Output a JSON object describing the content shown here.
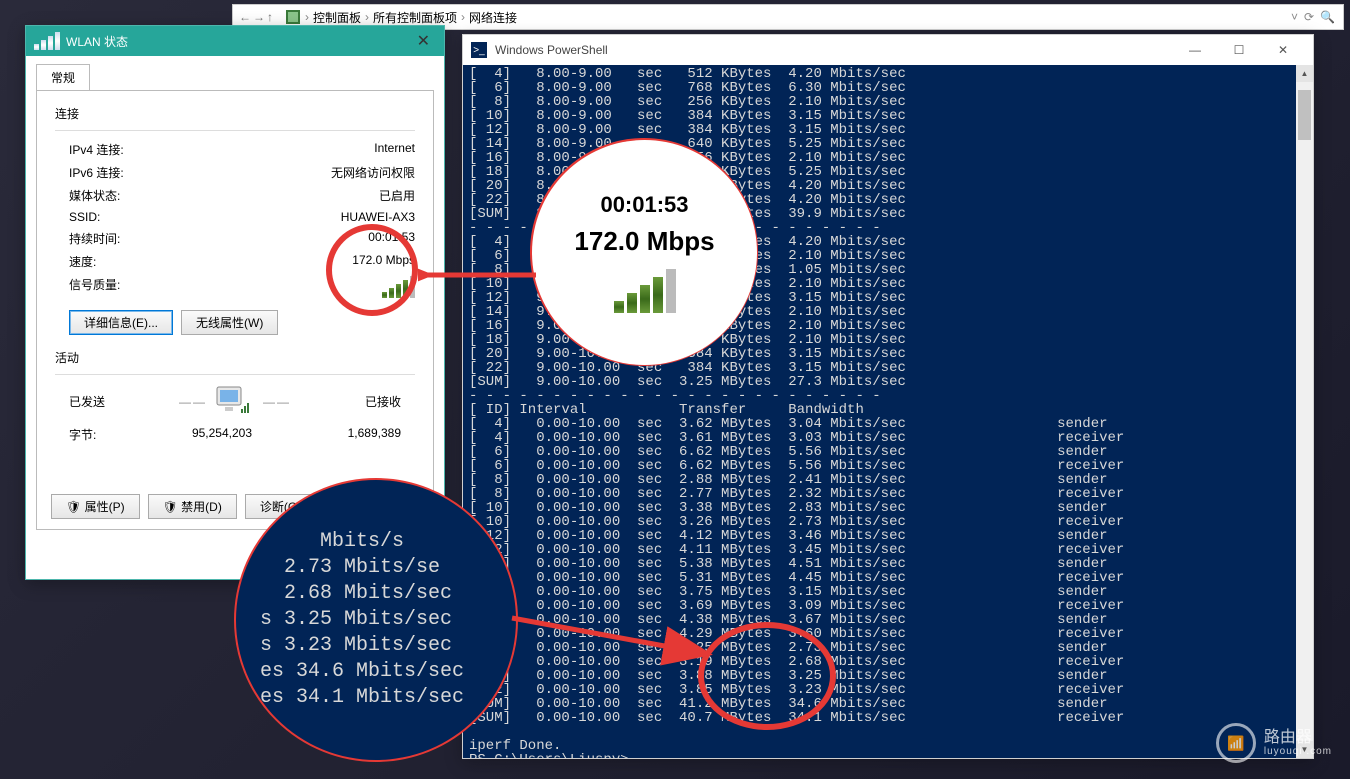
{
  "explorer": {
    "back": "←",
    "fwd": "→",
    "up": "↑",
    "cp_icon": "⚙",
    "crumbs": [
      "控制面板",
      "所有控制面板项",
      "网络连接"
    ],
    "sep": "›",
    "refresh": "⟳",
    "dropdown": "˅",
    "search": "🔍"
  },
  "wlan": {
    "title": "WLAN 状态",
    "tab_general": "常规",
    "section_connection": "连接",
    "rows": {
      "ipv4_k": "IPv4 连接:",
      "ipv4_v": "Internet",
      "ipv6_k": "IPv6 连接:",
      "ipv6_v": "无网络访问权限",
      "media_k": "媒体状态:",
      "media_v": "已启用",
      "ssid_k": "SSID:",
      "ssid_v": "HUAWEI-AX3",
      "dur_k": "持续时间:",
      "dur_v": "00:01:53",
      "speed_k": "速度:",
      "speed_v": "172.0 Mbps",
      "sig_k": "信号质量:"
    },
    "btn_details": "详细信息(E)...",
    "btn_wireless": "无线属性(W)",
    "section_activity": "活动",
    "sent_label": "已发送",
    "recv_label": "已接收",
    "bytes_label": "字节:",
    "sent_bytes": "95,254,203",
    "recv_bytes": "1,689,389",
    "btn_props": "属性(P)",
    "btn_disable": "禁用(D)",
    "btn_diag": "诊断(G)",
    "close": "✕"
  },
  "powershell": {
    "title": "Windows PowerShell",
    "icon": ">_",
    "min": "—",
    "max": "☐",
    "close": "✕",
    "prompt": "PS C:\\Users\\Liuspy>",
    "done": "iperf Done.",
    "block1_header": "",
    "block1": [
      "[  4]   8.00-9.00   sec   512 KBytes  4.20 Mbits/sec",
      "[  6]   8.00-9.00   sec   768 KBytes  6.30 Mbits/sec",
      "[  8]   8.00-9.00   sec   256 KBytes  2.10 Mbits/sec",
      "[ 10]   8.00-9.00   sec   384 KBytes  3.15 Mbits/sec",
      "[ 12]   8.00-9.00   sec   384 KBytes  3.15 Mbits/sec",
      "[ 14]   8.00-9.00   sec   640 KBytes  5.25 Mbits/sec",
      "[ 16]   8.00-9.00   sec   256 KBytes  2.10 Mbits/sec",
      "[ 18]   8.00-9.00   sec   640 KBytes  5.25 Mbits/sec",
      "[ 20]   8.00-9.00   sec   512 KBytes  4.20 Mbits/sec",
      "[ 22]   8.00-9.00   sec   512 KBytes  4.20 Mbits/sec",
      "[SUM]   8.00-9.00   sec  4.75 MBytes  39.9 Mbits/sec"
    ],
    "gap1": "- - - - - - - - - - - - - - - - - - - - - - - - -",
    "block2": [
      "[  4]   9.00-10.00  sec   512 KBytes  4.20 Mbits/sec",
      "[  6]   9.00-10.00  sec   256 KBytes  2.10 Mbits/sec",
      "[  8]   9.00-10.00  sec   128 KBytes  1.05 Mbits/sec",
      "[ 10]   9.00-10.00  sec   256 KBytes  2.10 Mbits/sec",
      "[ 12]   9.00-10.00  sec   384 KBytes  3.15 Mbits/sec",
      "[ 14]   9.00-10.00  sec   256 KBytes  2.10 Mbits/sec",
      "[ 16]   9.00-10.00  sec   256 KBytes  2.10 Mbits/sec",
      "[ 18]   9.00-10.00  sec   256 KBytes  2.10 Mbits/sec",
      "[ 20]   9.00-10.00  sec   384 KBytes  3.15 Mbits/sec",
      "[ 22]   9.00-10.00  sec   384 KBytes  3.15 Mbits/sec",
      "[SUM]   9.00-10.00  sec  3.25 MBytes  27.3 Mbits/sec"
    ],
    "summary_header": "[ ID] Interval           Transfer     Bandwidth",
    "summary": [
      "[  4]   0.00-10.00  sec  3.62 MBytes  3.04 Mbits/sec                  sender",
      "[  4]   0.00-10.00  sec  3.61 MBytes  3.03 Mbits/sec                  receiver",
      "[  6]   0.00-10.00  sec  6.62 MBytes  5.56 Mbits/sec                  sender",
      "[  6]   0.00-10.00  sec  6.62 MBytes  5.56 Mbits/sec                  receiver",
      "[  8]   0.00-10.00  sec  2.88 MBytes  2.41 Mbits/sec                  sender",
      "[  8]   0.00-10.00  sec  2.77 MBytes  2.32 Mbits/sec                  receiver",
      "[ 10]   0.00-10.00  sec  3.38 MBytes  2.83 Mbits/sec                  sender",
      "[ 10]   0.00-10.00  sec  3.26 MBytes  2.73 Mbits/sec                  receiver",
      "[ 12]   0.00-10.00  sec  4.12 MBytes  3.46 Mbits/sec                  sender",
      "[ 12]   0.00-10.00  sec  4.11 MBytes  3.45 Mbits/sec                  receiver",
      "[ 14]   0.00-10.00  sec  5.38 MBytes  4.51 Mbits/sec                  sender",
      "[ 14]   0.00-10.00  sec  5.31 MBytes  4.45 Mbits/sec                  receiver",
      "[ 16]   0.00-10.00  sec  3.75 MBytes  3.15 Mbits/sec                  sender",
      "[ 16]   0.00-10.00  sec  3.69 MBytes  3.09 Mbits/sec                  receiver",
      "[ 18]   0.00-10.00  sec  4.38 MBytes  3.67 Mbits/sec                  sender",
      "[ 18]   0.00-10.00  sec  4.29 MBytes  3.60 Mbits/sec                  receiver",
      "[ 20]   0.00-10.00  sec  3.25 MBytes  2.73 Mbits/sec                  sender",
      "[ 20]   0.00-10.00  sec  3.19 MBytes  2.68 Mbits/sec                  receiver",
      "[ 22]   0.00-10.00  sec  3.88 MBytes  3.25 Mbits/sec                  sender",
      "[ 22]   0.00-10.00  sec  3.85 MBytes  3.23 Mbits/sec                  receiver",
      "[SUM]   0.00-10.00  sec  41.2 MBytes  34.6 Mbits/sec                  sender",
      "[SUM]   0.00-10.00  sec  40.7 MBytes  34.1 Mbits/sec                  receiver"
    ]
  },
  "callout_top": {
    "duration": "00:01:53",
    "speed": "172.0 Mbps"
  },
  "callout_bottom_lines": [
    "     Mbits/s",
    "  2.73 Mbits/se",
    "  2.68 Mbits/sec",
    "s 3.25 Mbits/sec",
    "s 3.23 Mbits/sec",
    "es 34.6 Mbits/sec",
    "es 34.1 Mbits/sec"
  ],
  "watermark": {
    "cn": "路由器",
    "en": "luyouqi .com"
  }
}
